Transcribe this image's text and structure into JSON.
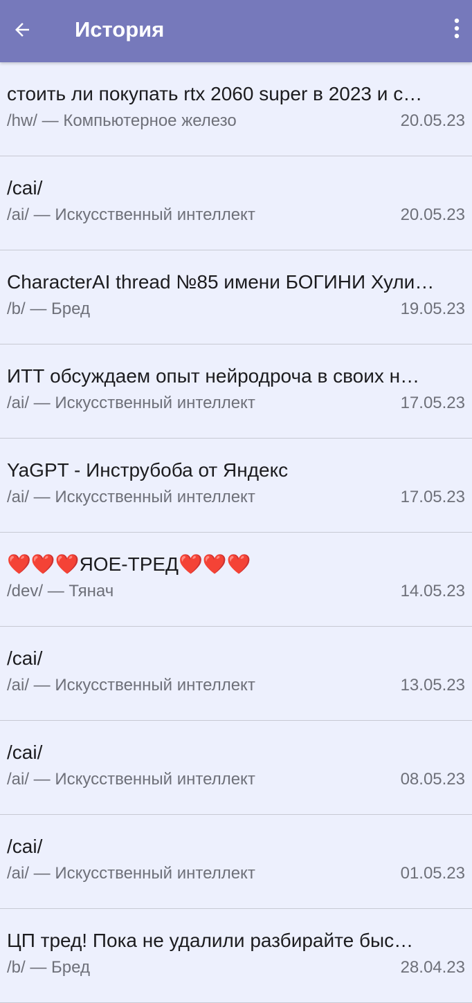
{
  "appbar": {
    "title": "История",
    "background": "#7679bb",
    "back_icon": "arrow-left-icon",
    "menu_icon": "more-vert-icon"
  },
  "history": [
    {
      "title": "стоить ли покупать rtx 2060 super в 2023 и с…",
      "board": "/hw/ — Компьютерное железо",
      "date": "20.05.23"
    },
    {
      "title": "/cai/",
      "board": "/ai/ — Искусственный интеллект",
      "date": "20.05.23"
    },
    {
      "title": "CharacterAI thread №85 имени БОГИНИ Хули…",
      "board": "/b/ — Бред",
      "date": "19.05.23"
    },
    {
      "title": "ИТТ обсуждаем опыт нейродроча в своих н…",
      "board": "/ai/ — Искусственный интеллект",
      "date": "17.05.23"
    },
    {
      "title": "YaGPT - Инструбоба от Яндекс",
      "board": "/ai/ — Искусственный интеллект",
      "date": "17.05.23"
    },
    {
      "title": "❤️❤️❤️ЯОЕ-ТРЕД❤️❤️❤️",
      "board": "/dev/ — Тянач",
      "date": "14.05.23"
    },
    {
      "title": "/cai/",
      "board": "/ai/ — Искусственный интеллект",
      "date": "13.05.23"
    },
    {
      "title": "/cai/",
      "board": "/ai/ — Искусственный интеллект",
      "date": "08.05.23"
    },
    {
      "title": "/cai/",
      "board": "/ai/ — Искусственный интеллект",
      "date": "01.05.23"
    },
    {
      "title": "ЦП тред!  Пока не удалили разбирайте быс…",
      "board": "/b/ — Бред",
      "date": "28.04.23"
    }
  ]
}
